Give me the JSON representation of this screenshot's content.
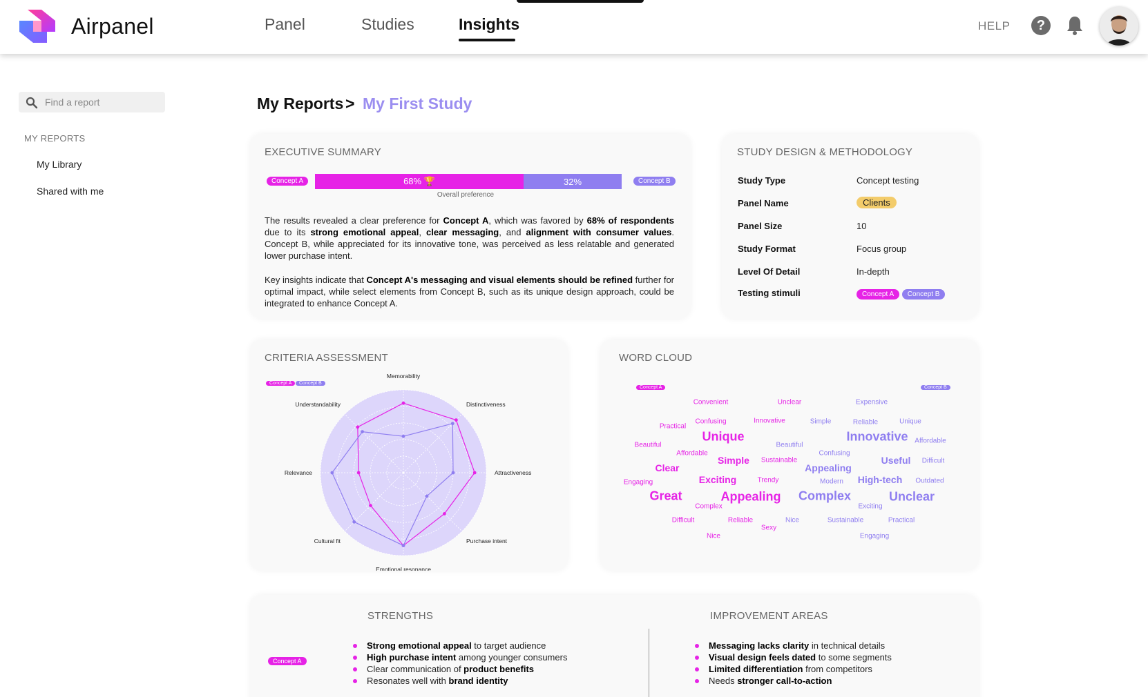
{
  "app": {
    "name": "Airpanel"
  },
  "nav": {
    "tabs": [
      {
        "label": "Panel"
      },
      {
        "label": "Studies"
      },
      {
        "label": "Insights"
      }
    ],
    "help_label": "HELP"
  },
  "icons": {
    "help": "question-circle-icon",
    "bell": "bell-icon",
    "search": "search-icon",
    "avatar": "user-avatar"
  },
  "sidebar": {
    "search_placeholder": "Find a report",
    "heading": "MY REPORTS",
    "items": [
      {
        "label": "My Library"
      },
      {
        "label": "Shared with me"
      }
    ]
  },
  "breadcrumb": {
    "root": "My Reports",
    "separator": ">",
    "current": "My First Study"
  },
  "colors": {
    "concept_a": "#e623e6",
    "concept_b": "#8f7ef0",
    "accent": "#9b8ef0",
    "panel_chip": "#f3cc6b"
  },
  "concepts": {
    "a": "Concept A",
    "b": "Concept B"
  },
  "executive_summary": {
    "title": "EXECUTIVE SUMMARY",
    "preference": {
      "a_pct": 68,
      "b_pct": 32,
      "a_label": "68% 🏆",
      "b_label": "32%",
      "caption": "Overall preference"
    },
    "p1": [
      {
        "t": "The results revealed a clear preference for "
      },
      {
        "t": "Concept A",
        "b": true
      },
      {
        "t": ", which was favored by "
      },
      {
        "t": "68% of respondents",
        "b": true
      },
      {
        "t": " due to its "
      },
      {
        "t": "strong emotional appeal",
        "b": true
      },
      {
        "t": ", "
      },
      {
        "t": "clear messaging",
        "b": true
      },
      {
        "t": ", and "
      },
      {
        "t": "alignment with consumer values",
        "b": true
      },
      {
        "t": ". Concept B, while appreciated for its innovative tone, was perceived as less relatable and generated lower purchase intent."
      }
    ],
    "p2": [
      {
        "t": "Key insights indicate that "
      },
      {
        "t": "Concept A's messaging and visual elements should be refined",
        "b": true
      },
      {
        "t": " further for optimal impact, while select elements from Concept B, such as its unique design approach, could be integrated to enhance Concept A."
      }
    ]
  },
  "study_design": {
    "title": "STUDY DESIGN & METHODOLOGY",
    "rows": [
      {
        "label": "Study Type",
        "value": "Concept testing"
      },
      {
        "label": "Panel Name",
        "value": "Clients"
      },
      {
        "label": "Panel Size",
        "value": "10"
      },
      {
        "label": "Study Format",
        "value": "Focus group"
      },
      {
        "label": "Level Of Detail",
        "value": "In-depth"
      },
      {
        "label": "Testing stimuli",
        "value": ""
      }
    ]
  },
  "criteria": {
    "title": "CRITERIA ASSESSMENT",
    "chart_data": {
      "type": "radar",
      "axes": [
        "Memorability",
        "Distinctiveness",
        "Attractiveness",
        "Purchase intent",
        "Emotional resonance",
        "Cultural fit",
        "Relevance",
        "Understandability"
      ],
      "rmax": 5,
      "series": [
        {
          "name": "Concept A",
          "values": [
            4.2,
            4.5,
            4.3,
            3.5,
            4.4,
            2.8,
            2.7,
            3.9
          ]
        },
        {
          "name": "Concept B",
          "values": [
            2.2,
            4.2,
            3.0,
            2.0,
            4.4,
            4.2,
            4.3,
            3.5
          ]
        }
      ]
    }
  },
  "word_cloud": {
    "title": "WORD CLOUD",
    "words": [
      {
        "text": "Convenient",
        "c": "a",
        "s": 10
      },
      {
        "text": "Unclear",
        "c": "a",
        "s": 10
      },
      {
        "text": "Expensive",
        "c": "b",
        "s": 10
      },
      {
        "text": "Practical",
        "c": "a",
        "s": 10
      },
      {
        "text": "Confusing",
        "c": "a",
        "s": 10
      },
      {
        "text": "Innovative",
        "c": "a",
        "s": 10
      },
      {
        "text": "Simple",
        "c": "b",
        "s": 10
      },
      {
        "text": "Reliable",
        "c": "b",
        "s": 10
      },
      {
        "text": "Unique",
        "c": "b",
        "s": 10
      },
      {
        "text": "Unique",
        "c": "a",
        "s": 18
      },
      {
        "text": "Innovative",
        "c": "b",
        "s": 18
      },
      {
        "text": "Beautiful",
        "c": "a",
        "s": 10
      },
      {
        "text": "Beautiful",
        "c": "b",
        "s": 10
      },
      {
        "text": "Affordable",
        "c": "b",
        "s": 10
      },
      {
        "text": "Affordable",
        "c": "a",
        "s": 10
      },
      {
        "text": "Confusing",
        "c": "b",
        "s": 10
      },
      {
        "text": "Simple",
        "c": "a",
        "s": 14
      },
      {
        "text": "Sustainable",
        "c": "a",
        "s": 10
      },
      {
        "text": "Useful",
        "c": "b",
        "s": 14
      },
      {
        "text": "Difficult",
        "c": "b",
        "s": 10
      },
      {
        "text": "Clear",
        "c": "a",
        "s": 14
      },
      {
        "text": "Appealing",
        "c": "b",
        "s": 14
      },
      {
        "text": "Engaging",
        "c": "a",
        "s": 10
      },
      {
        "text": "Exciting",
        "c": "a",
        "s": 14
      },
      {
        "text": "Trendy",
        "c": "a",
        "s": 10
      },
      {
        "text": "Modern",
        "c": "b",
        "s": 10
      },
      {
        "text": "High-tech",
        "c": "b",
        "s": 14
      },
      {
        "text": "Outdated",
        "c": "b",
        "s": 10
      },
      {
        "text": "Great",
        "c": "a",
        "s": 18
      },
      {
        "text": "Appealing",
        "c": "a",
        "s": 18
      },
      {
        "text": "Complex",
        "c": "b",
        "s": 18
      },
      {
        "text": "Unclear",
        "c": "b",
        "s": 18
      },
      {
        "text": "Complex",
        "c": "a",
        "s": 10
      },
      {
        "text": "Exciting",
        "c": "b",
        "s": 10
      },
      {
        "text": "Difficult",
        "c": "a",
        "s": 10
      },
      {
        "text": "Reliable",
        "c": "a",
        "s": 10
      },
      {
        "text": "Nice",
        "c": "b",
        "s": 10
      },
      {
        "text": "Sustainable",
        "c": "b",
        "s": 10
      },
      {
        "text": "Practical",
        "c": "b",
        "s": 10
      },
      {
        "text": "Sexy",
        "c": "a",
        "s": 10
      },
      {
        "text": "Nice",
        "c": "a",
        "s": 10
      },
      {
        "text": "Engaging",
        "c": "b",
        "s": 10
      }
    ]
  },
  "strengths": {
    "title": "STRENGTHS",
    "items": [
      [
        {
          "t": "Strong emotional appeal",
          "b": true
        },
        {
          "t": " to target audience"
        }
      ],
      [
        {
          "t": "High purchase intent",
          "b": true
        },
        {
          "t": " among younger consumers"
        }
      ],
      [
        {
          "t": "Clear communication of "
        },
        {
          "t": "product benefits",
          "b": true
        }
      ],
      [
        {
          "t": "Resonates well with "
        },
        {
          "t": "brand identity",
          "b": true
        }
      ]
    ]
  },
  "improvements": {
    "title": "IMPROVEMENT AREAS",
    "items": [
      [
        {
          "t": "Messaging lacks clarity",
          "b": true
        },
        {
          "t": " in technical details"
        }
      ],
      [
        {
          "t": "Visual design feels dated",
          "b": true
        },
        {
          "t": " to some segments"
        }
      ],
      [
        {
          "t": "Limited differentiation",
          "b": true
        },
        {
          "t": " from competitors"
        }
      ],
      [
        {
          "t": "Needs "
        },
        {
          "t": "stronger call-to-action",
          "b": true
        }
      ]
    ]
  }
}
